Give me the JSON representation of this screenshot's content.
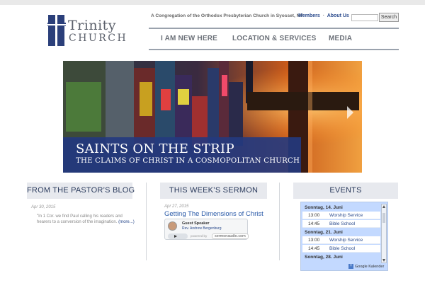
{
  "logo": {
    "word1": "Trinity",
    "word2": "CHURCH"
  },
  "header": {
    "tagline": "A Congregation of the Orthodox Presbyterian Church in Syosset, NY",
    "links": [
      "Members",
      "About Us"
    ],
    "link_separator": "·",
    "search_button": "Search"
  },
  "nav": {
    "items": [
      "I AM NEW HERE",
      "LOCATION & SERVICES",
      "MEDIA"
    ]
  },
  "hero": {
    "title": "SAINTS ON THE STRIP",
    "subtitle": "THE CLAIMS OF CHRIST IN A COSMOPOLITAN CHURCH"
  },
  "blog": {
    "heading": "FROM THE PASTOR’S BLOG",
    "date": "Apr 30, 2015",
    "excerpt": "\"In 1 Cor. we find Paul calling his readers and hearers to a conversion of the imagination.",
    "more": "(more...)"
  },
  "sermon": {
    "heading": "THIS WEEK’S SERMON",
    "date": "Apr 27, 2015",
    "title": "Getting The Dimensions of Christ",
    "label": "Guest Speaker",
    "speaker": "Rev. Andrew Bergenburg",
    "brand_left": "powered by",
    "brand": "sermonaudio.com"
  },
  "events": {
    "heading": "EVENTS",
    "days": [
      {
        "date": "Sonntag, 14. Juni",
        "items": [
          {
            "time": "13:00",
            "title": "Worship Service"
          },
          {
            "time": "14:45",
            "title": "Bible School"
          }
        ]
      },
      {
        "date": "Sonntag, 21. Juni",
        "items": [
          {
            "time": "13:00",
            "title": "Worship Service"
          },
          {
            "time": "14:45",
            "title": "Bible School"
          }
        ]
      },
      {
        "date": "Sonntag, 28. Juni",
        "items": []
      }
    ],
    "footer_plus": "+",
    "footer_label": "Google Kalender"
  },
  "colors": {
    "accent": "#2a4a8c",
    "banner": "#243a80",
    "nav_text": "#6b7078",
    "head_bg": "#e7e9ee"
  }
}
